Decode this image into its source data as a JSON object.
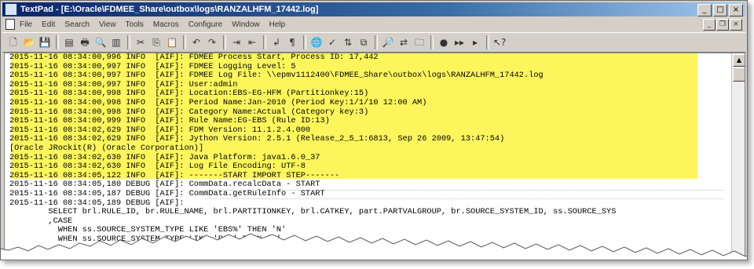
{
  "window": {
    "title": "TextPad - [E:\\Oracle\\FDMEE_Share\\outbox\\logs\\RANZALHFM_17442.log]"
  },
  "titlebar_buttons": [
    {
      "name": "minimize-button",
      "label": "_"
    },
    {
      "name": "maximize-button",
      "label": "□"
    },
    {
      "name": "close-button",
      "label": "×"
    }
  ],
  "menu": [
    "File",
    "Edit",
    "Search",
    "View",
    "Tools",
    "Macros",
    "Configure",
    "Window",
    "Help"
  ],
  "mdi_buttons": [
    {
      "name": "mdi-minimize-button",
      "label": "_"
    },
    {
      "name": "mdi-restore-button",
      "label": "❐"
    },
    {
      "name": "mdi-close-button",
      "label": "×"
    }
  ],
  "toolbar": [
    {
      "name": "new-file-icon",
      "glyph": "🗋"
    },
    {
      "name": "open-folder-icon",
      "glyph": "📂"
    },
    {
      "name": "save-icon",
      "glyph": "💾"
    },
    {
      "sep": true
    },
    {
      "name": "save-all-icon",
      "glyph": "▤"
    },
    {
      "name": "print-icon",
      "glyph": "🖶"
    },
    {
      "name": "print-preview-icon",
      "glyph": "🔍"
    },
    {
      "name": "manage-files-icon",
      "glyph": "▥"
    },
    {
      "sep": true
    },
    {
      "name": "cut-icon",
      "glyph": "✂"
    },
    {
      "name": "copy-icon",
      "glyph": "⎘"
    },
    {
      "name": "paste-icon",
      "glyph": "📋"
    },
    {
      "sep": true
    },
    {
      "name": "undo-icon",
      "glyph": "↶"
    },
    {
      "name": "redo-icon",
      "glyph": "↷"
    },
    {
      "sep": true
    },
    {
      "name": "indent-icon",
      "glyph": "⇥"
    },
    {
      "name": "outdent-icon",
      "glyph": "⇤"
    },
    {
      "sep": true
    },
    {
      "name": "word-wrap-icon",
      "glyph": "↲"
    },
    {
      "name": "visible-spaces-icon",
      "glyph": "¶"
    },
    {
      "sep": true
    },
    {
      "name": "web-browser-icon",
      "glyph": "🌐"
    },
    {
      "name": "spelling-icon",
      "glyph": "✓"
    },
    {
      "name": "sort-icon",
      "glyph": "⇅"
    },
    {
      "name": "compare-files-icon",
      "glyph": "⧉"
    },
    {
      "sep": true
    },
    {
      "name": "find-icon",
      "glyph": "🔎"
    },
    {
      "name": "replace-icon",
      "glyph": "⇄"
    },
    {
      "name": "find-in-files-icon",
      "glyph": "🗀"
    },
    {
      "sep": true
    },
    {
      "name": "bookmark-icon",
      "glyph": "●"
    },
    {
      "name": "record-macro-icon",
      "glyph": "▸▸"
    },
    {
      "name": "playback-macro-icon",
      "glyph": "▸"
    },
    {
      "sep": true
    },
    {
      "name": "context-help-icon",
      "glyph": "↖?"
    }
  ],
  "log_lines": [
    "2015-11-16 08:34:00,996 INFO  [AIF]: FDMEE Process Start, Process ID: 17,442",
    "2015-11-16 08:34:00,997 INFO  [AIF]: FDMEE Logging Level: 5",
    "2015-11-16 08:34:00,997 INFO  [AIF]: FDMEE Log File: \\\\epmv1112400\\FDMEE_Share\\outbox\\logs\\RANZALHFM_17442.log",
    "2015-11-16 08:34:00,997 INFO  [AIF]: User:admin",
    "2015-11-16 08:34:00,998 INFO  [AIF]: Location:EBS-EG-HFM (Partitionkey:15)",
    "2015-11-16 08:34:00,998 INFO  [AIF]: Period Name:Jan-2010 (Period Key:1/1/10 12:00 AM)",
    "2015-11-16 08:34:00,998 INFO  [AIF]: Category Name:Actual (Category key:3)",
    "2015-11-16 08:34:00,999 INFO  [AIF]: Rule Name:EG-EBS (Rule ID:13)",
    "2015-11-16 08:34:02,629 INFO  [AIF]: FDM Version: 11.1.2.4.000",
    "2015-11-16 08:34:02,629 INFO  [AIF]: Jython Version: 2.5.1 (Release_2_5_1:6813, Sep 26 2009, 13:47:54)",
    "[Oracle JRockit(R) (Oracle Corporation)]",
    "2015-11-16 08:34:02,630 INFO  [AIF]: Java Platform: java1.6.0_37",
    "2015-11-16 08:34:02,630 INFO  [AIF]: Log File Encoding: UTF-8",
    "2015-11-16 08:34:05,122 INFO  [AIF]: -------START IMPORT STEP-------",
    "2015-11-16 08:34:05,180 DEBUG [AIF]: CommData.recalcData - START",
    "2015-11-16 08:34:05,187 DEBUG [AIF]: CommData.getRuleInfo - START",
    "2015-11-16 08:34:05,189 DEBUG [AIF]:",
    "        SELECT brl.RULE_ID, br.RULE_NAME, brl.PARTITIONKEY, brl.CATKEY, part.PARTVALGROUP, br.SOURCE_SYSTEM_ID, ss.SOURCE_SYS",
    "        ,CASE",
    "          WHEN ss.SOURCE_SYSTEM_TYPE LIKE 'EBS%' THEN 'N'",
    "          WHEN ss.SOURCE_SYSTEM_TYPE LIKE 'PS%' THEN 'N'"
  ]
}
